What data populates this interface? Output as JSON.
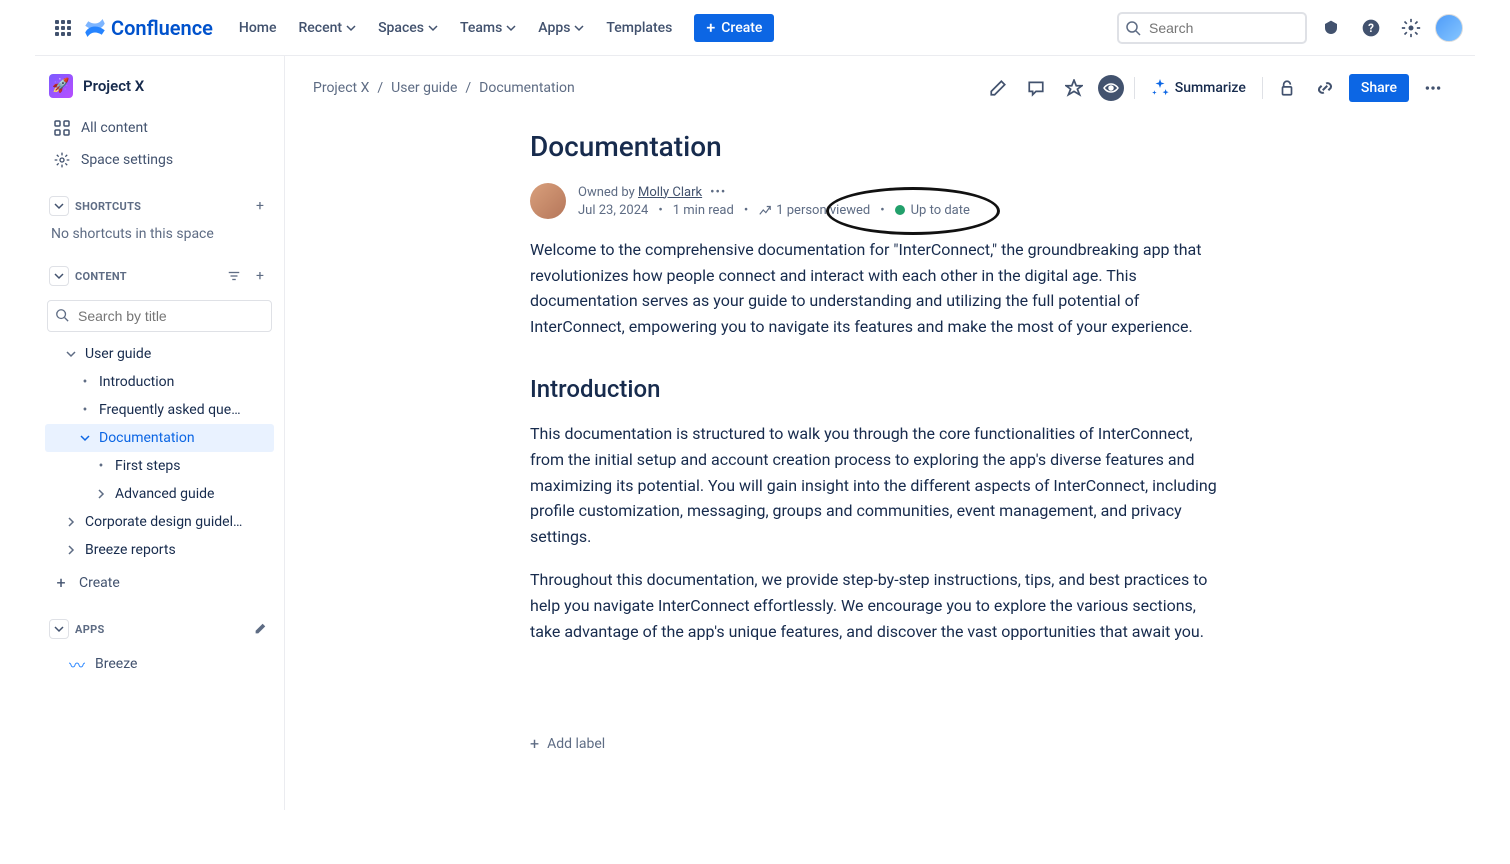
{
  "topnav": {
    "product": "Confluence",
    "items": [
      "Home",
      "Recent",
      "Spaces",
      "Teams",
      "Apps",
      "Templates"
    ],
    "create": "Create",
    "search_placeholder": "Search"
  },
  "sidebar": {
    "space": "Project X",
    "all_content": "All content",
    "space_settings": "Space settings",
    "shortcuts_label": "SHORTCUTS",
    "shortcuts_empty": "No shortcuts in this space",
    "content_label": "CONTENT",
    "title_search_placeholder": "Search by title",
    "tree": {
      "user_guide": "User guide",
      "introduction": "Introduction",
      "faq": "Frequently asked que…",
      "documentation": "Documentation",
      "first_steps": "First steps",
      "advanced_guide": "Advanced guide",
      "corporate": "Corporate design guidel…",
      "breeze_reports": "Breeze reports"
    },
    "create_page": "Create",
    "apps_label": "APPS",
    "breeze": "Breeze"
  },
  "breadcrumb": {
    "space": "Project X",
    "parent": "User guide",
    "current": "Documentation"
  },
  "actions": {
    "summarize": "Summarize",
    "share": "Share"
  },
  "page": {
    "title": "Documentation",
    "owned_by_label": "Owned by",
    "owner": "Molly Clark",
    "date": "Jul 23, 2024",
    "read_time": "1 min read",
    "viewed": "1 person viewed",
    "status": "Up to date",
    "intro_para": "Welcome to the comprehensive documentation for \"InterConnect,\" the groundbreaking app that revolutionizes how people connect and interact with each other in the digital age. This documentation serves as your guide to understanding and utilizing the full potential of InterConnect, empowering you to navigate its features and make the most of your experience.",
    "h2": "Introduction",
    "p2": "This documentation is structured to walk you through the core functionalities of InterConnect, from the initial setup and account creation process to exploring the app's diverse features and maximizing its potential. You will gain insight into the different aspects of InterConnect, including profile customization, messaging, groups and communities, event management, and privacy settings.",
    "p3": "Throughout this documentation, we provide step-by-step instructions, tips, and best practices to help you navigate InterConnect effortlessly. We encourage you to explore the various sections, take advantage of the app's unique features, and discover the vast opportunities that await you.",
    "add_label": "Add label"
  }
}
